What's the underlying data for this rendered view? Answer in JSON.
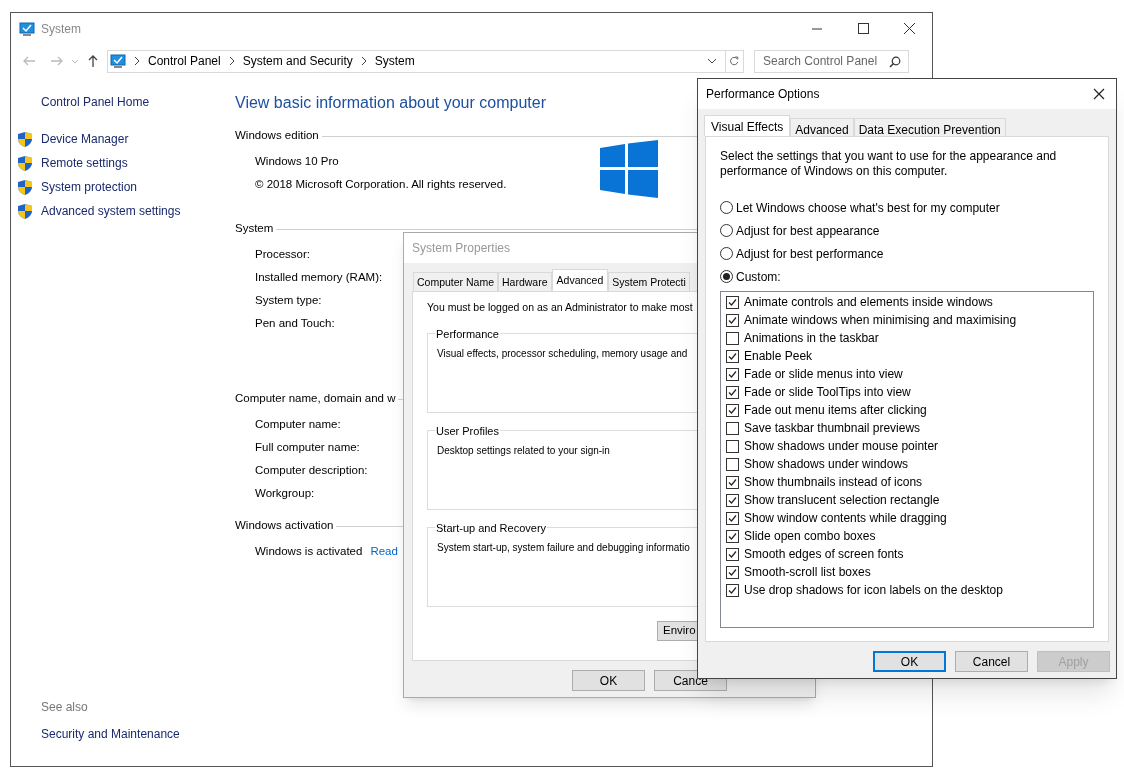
{
  "system_window": {
    "title": "System",
    "address_bar": {
      "segments": [
        "Control Panel",
        "System and Security",
        "System"
      ]
    },
    "search": {
      "placeholder": "Search Control Panel"
    },
    "left_pane": {
      "home_link": "Control Panel Home",
      "links": [
        "Device Manager",
        "Remote settings",
        "System protection",
        "Advanced system settings"
      ],
      "see_also": {
        "heading": "See also",
        "links": [
          "Security and Maintenance"
        ]
      }
    },
    "heading": "View basic information about your computer",
    "sections": [
      {
        "title": "Windows edition",
        "rows": [
          {
            "label": "Windows 10 Pro"
          },
          {
            "label": "© 2018 Microsoft Corporation. All rights reserved."
          }
        ]
      },
      {
        "title": "System",
        "rows": [
          {
            "label": "Processor:"
          },
          {
            "label": "Installed memory (RAM):"
          },
          {
            "label": "System type:"
          },
          {
            "label": "Pen and Touch:"
          }
        ]
      },
      {
        "title": "Computer name, domain and w",
        "rows": [
          {
            "label": "Computer name:"
          },
          {
            "label": "Full computer name:"
          },
          {
            "label": "Computer description:"
          },
          {
            "label": "Workgroup:"
          }
        ]
      },
      {
        "title": "Windows activation",
        "rows": [
          {
            "label": "Windows is activated",
            "link": "Read"
          }
        ]
      }
    ]
  },
  "system_properties": {
    "title": "System Properties",
    "tabs": [
      {
        "label": "Computer Name",
        "selected": false
      },
      {
        "label": "Hardware",
        "selected": false
      },
      {
        "label": "Advanced",
        "selected": true
      },
      {
        "label": "System Protecti",
        "selected": false
      }
    ],
    "notice": "You must be logged on as an Administrator to make most",
    "groups": [
      {
        "title": "Performance",
        "description": "Visual effects, processor scheduling, memory usage and"
      },
      {
        "title": "User Profiles",
        "description": "Desktop settings related to your sign-in"
      },
      {
        "title": "Start-up and Recovery",
        "description": "System start-up, system failure and debugging informatio"
      }
    ],
    "side_button": "Enviro",
    "buttons": [
      {
        "label": "OK",
        "disabled": false
      },
      {
        "label": "Cance",
        "disabled": false
      }
    ]
  },
  "performance_options": {
    "title": "Performance Options",
    "tabs": [
      {
        "label": "Visual Effects",
        "selected": true
      },
      {
        "label": "Advanced",
        "selected": false
      },
      {
        "label": "Data Execution Prevention",
        "selected": false
      }
    ],
    "description": "Select the settings that you want to use for the appearance and performance of Windows on this computer.",
    "options": [
      {
        "label": "Let Windows choose what's best for my computer",
        "selected": false
      },
      {
        "label": "Adjust for best appearance",
        "selected": false
      },
      {
        "label": "Adjust for best performance",
        "selected": false
      },
      {
        "label": "Custom:",
        "selected": true
      }
    ],
    "effects": [
      {
        "label": "Animate controls and elements inside windows",
        "checked": true
      },
      {
        "label": "Animate windows when minimising and maximising",
        "checked": true
      },
      {
        "label": "Animations in the taskbar",
        "checked": false
      },
      {
        "label": "Enable Peek",
        "checked": true
      },
      {
        "label": "Fade or slide menus into view",
        "checked": true
      },
      {
        "label": "Fade or slide ToolTips into view",
        "checked": true
      },
      {
        "label": "Fade out menu items after clicking",
        "checked": true
      },
      {
        "label": "Save taskbar thumbnail previews",
        "checked": false
      },
      {
        "label": "Show shadows under mouse pointer",
        "checked": false
      },
      {
        "label": "Show shadows under windows",
        "checked": false
      },
      {
        "label": "Show thumbnails instead of icons",
        "checked": true
      },
      {
        "label": "Show translucent selection rectangle",
        "checked": true
      },
      {
        "label": "Show window contents while dragging",
        "checked": true
      },
      {
        "label": "Slide open combo boxes",
        "checked": true
      },
      {
        "label": "Smooth edges of screen fonts",
        "checked": true
      },
      {
        "label": "Smooth-scroll list boxes",
        "checked": true
      },
      {
        "label": "Use drop shadows for icon labels on the desktop",
        "checked": true
      }
    ],
    "buttons": [
      {
        "label": "OK",
        "disabled": false,
        "default": true
      },
      {
        "label": "Cancel",
        "disabled": false,
        "default": false
      },
      {
        "label": "Apply",
        "disabled": true,
        "default": false
      }
    ]
  }
}
